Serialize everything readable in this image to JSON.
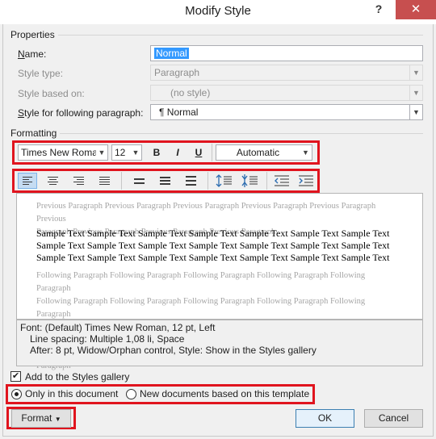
{
  "window": {
    "title": "Modify Style",
    "help_glyph": "?",
    "close_glyph": "✕"
  },
  "properties": {
    "section_label": "Properties",
    "name_label": "Name:",
    "name_value": "Normal",
    "style_type_label": "Style type:",
    "style_type_value": "Paragraph",
    "style_based_on_label": "Style based on:",
    "style_based_on_value": "(no style)",
    "following_label": "Style for following paragraph:",
    "following_value": "¶ Normal"
  },
  "formatting": {
    "section_label": "Formatting",
    "font": "Times New Roman",
    "size": "12",
    "bold": "B",
    "italic": "I",
    "underline": "U",
    "color": "Automatic",
    "alignment": "left"
  },
  "preview": {
    "previous_line_1": "Previous Paragraph Previous Paragraph Previous Paragraph Previous Paragraph Previous Paragraph Previous",
    "previous_line_2": "Paragraph Previous Paragraph Previous Paragraph Previous Paragraph",
    "sample_line": "Sample Text Sample Text Sample Text Sample Text Sample Text Sample Text Sample Text",
    "following_line": "Following Paragraph Following Paragraph Following Paragraph Following Paragraph Following Paragraph"
  },
  "description": {
    "line1": "Font: (Default) Times New Roman, 12 pt, Left",
    "line2": "Line spacing:  Multiple 1,08 li, Space",
    "line3": "After:  8 pt, Widow/Orphan control, Style: Show in the Styles gallery"
  },
  "options": {
    "add_to_gallery_label": "Add to the Styles gallery",
    "add_to_gallery_checked": true,
    "only_this_doc_label": "Only in this document",
    "new_docs_label": "New documents based on this template",
    "selected_scope": "only_this_document"
  },
  "buttons": {
    "format_label": "Format",
    "ok_label": "OK",
    "cancel_label": "Cancel"
  },
  "colors": {
    "highlight_box": "#e0141e",
    "selection": "#3399ff",
    "close_button": "#c74f4f"
  }
}
